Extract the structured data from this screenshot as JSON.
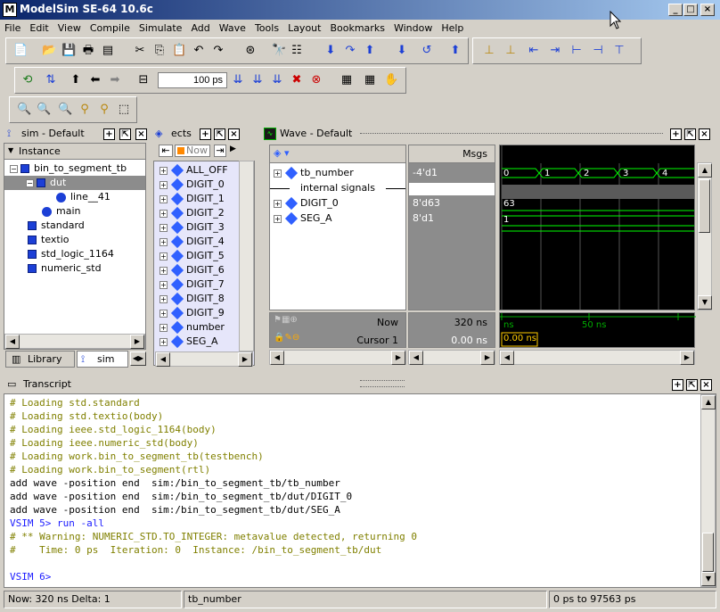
{
  "window": {
    "title": "ModelSim SE-64 10.6c",
    "icon": "modelsim-logo-icon"
  },
  "menu": [
    "File",
    "Edit",
    "View",
    "Compile",
    "Simulate",
    "Add",
    "Wave",
    "Tools",
    "Layout",
    "Bookmarks",
    "Window",
    "Help"
  ],
  "toolbar": {
    "run_length": "100 ps"
  },
  "sim_panel": {
    "title": "sim - Default",
    "column": "Instance",
    "items": [
      {
        "label": "bin_to_segment_tb",
        "kind": "block"
      },
      {
        "label": "dut",
        "kind": "block"
      },
      {
        "label": "line__41",
        "kind": "process"
      },
      {
        "label": "main",
        "kind": "process"
      },
      {
        "label": "standard",
        "kind": "package"
      },
      {
        "label": "textio",
        "kind": "package"
      },
      {
        "label": "std_logic_1164",
        "kind": "package"
      },
      {
        "label": "numeric_std",
        "kind": "package"
      }
    ],
    "tabs": [
      "Library",
      "sim"
    ]
  },
  "objects_panel": {
    "title": "ects",
    "filter": "Now",
    "items": [
      "ALL_OFF",
      "DIGIT_0",
      "DIGIT_1",
      "DIGIT_2",
      "DIGIT_3",
      "DIGIT_4",
      "DIGIT_5",
      "DIGIT_6",
      "DIGIT_7",
      "DIGIT_8",
      "DIGIT_9",
      "number",
      "SEG_A"
    ]
  },
  "wave_panel": {
    "title": "Wave - Default",
    "msgs_header": "Msgs",
    "signals": [
      {
        "name": "tb_number",
        "value": "-4'd1"
      },
      {
        "name": "internal signals",
        "value": "",
        "divider": true
      },
      {
        "name": "DIGIT_0",
        "value": "8'd63"
      },
      {
        "name": "SEG_A",
        "value": "8'd1"
      }
    ],
    "tb_number_segments": [
      "0",
      "1",
      "2",
      "3",
      "4"
    ],
    "digit0_value": "63",
    "sega_value": "1",
    "now_label": "Now",
    "now_value": "320 ns",
    "cursor_label": "Cursor 1",
    "cursor_value": "0.00 ns",
    "time_ticks": [
      "ns",
      "50 ns"
    ],
    "cursor_time": "0.00 ns"
  },
  "transcript": {
    "title": "Transcript",
    "lines": [
      {
        "text": "# Loading std.standard",
        "style": "comment"
      },
      {
        "text": "# Loading std.textio(body)",
        "style": "comment"
      },
      {
        "text": "# Loading ieee.std_logic_1164(body)",
        "style": "comment"
      },
      {
        "text": "# Loading ieee.numeric_std(body)",
        "style": "comment"
      },
      {
        "text": "# Loading work.bin_to_segment_tb(testbench)",
        "style": "comment"
      },
      {
        "text": "# Loading work.bin_to_segment(rtl)",
        "style": "comment"
      },
      {
        "text": "add wave -position end  sim:/bin_to_segment_tb/tb_number",
        "style": "cmd"
      },
      {
        "text": "add wave -position end  sim:/bin_to_segment_tb/dut/DIGIT_0",
        "style": "cmd"
      },
      {
        "text": "add wave -position end  sim:/bin_to_segment_tb/dut/SEG_A",
        "style": "cmd"
      },
      {
        "text": "VSIM 5> run -all",
        "style": "prompt"
      },
      {
        "text": "# ** Warning: NUMERIC_STD.TO_INTEGER: metavalue detected, returning 0",
        "style": "warn"
      },
      {
        "text": "#    Time: 0 ps  Iteration: 0  Instance: /bin_to_segment_tb/dut",
        "style": "warn"
      },
      {
        "text": "",
        "style": "cmd"
      },
      {
        "text": "VSIM 6>",
        "style": "prompt"
      }
    ]
  },
  "status": {
    "now": "Now: 320 ns  Delta: 1",
    "context": "tb_number",
    "range": "0 ps to 97563 ps"
  },
  "colors": {
    "wave_bg": "#000000",
    "wave_green": "#00ff00",
    "object_bg": "#e6e6fa",
    "selected": "#8c8c8c"
  }
}
